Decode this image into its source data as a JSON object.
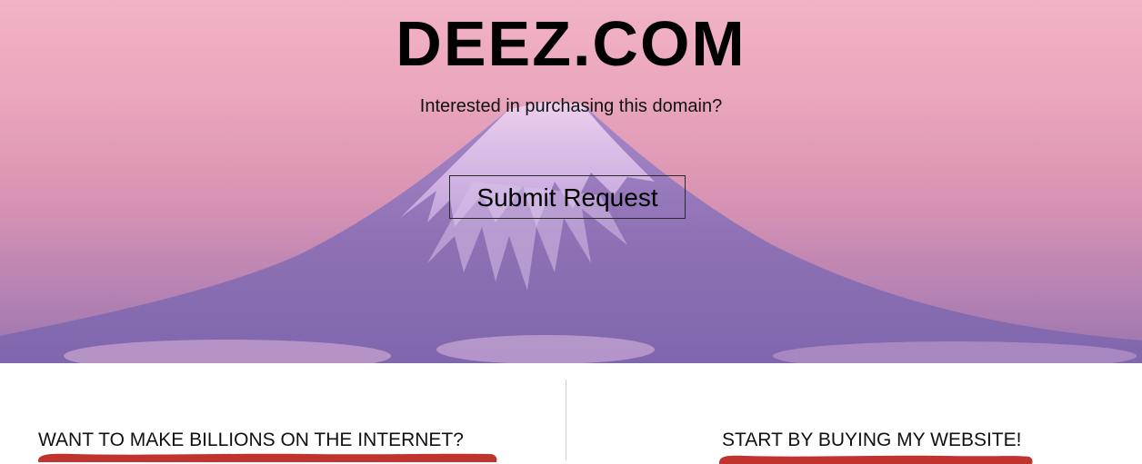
{
  "hero": {
    "title": "DEEZ.COM",
    "subtitle": "Interested in purchasing this domain?",
    "submit_label": "Submit Request",
    "background_image": "mountain-landscape"
  },
  "sections": {
    "left_heading": "WANT TO MAKE BILLIONS ON THE INTERNET?",
    "right_heading": "START BY BUYING MY WEBSITE!"
  },
  "colors": {
    "sky_top": "#f2b3c6",
    "mountain": "#8b6fb0",
    "accent_brush": "#c0332f",
    "text": "#000000"
  }
}
